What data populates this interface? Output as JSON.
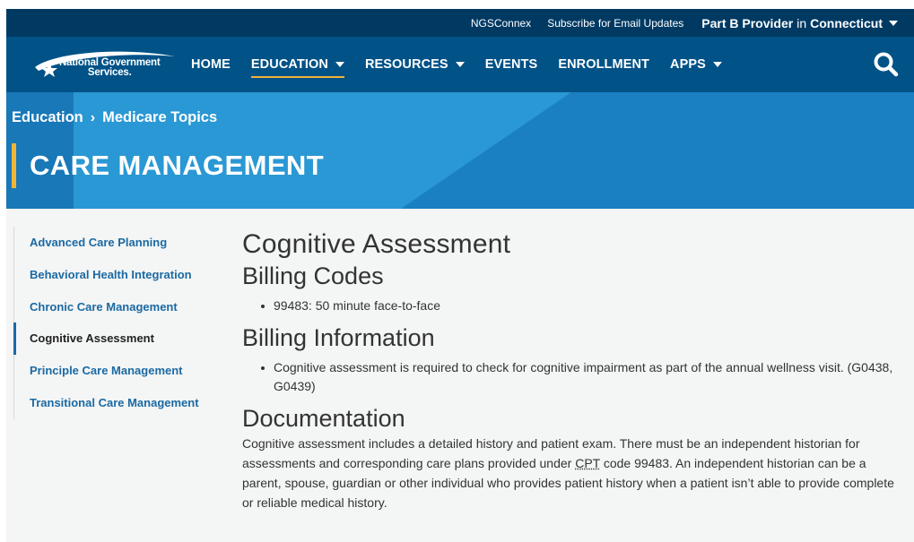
{
  "utility_bar": {
    "links": [
      "NGSConnex",
      "Subscribe for Email Updates"
    ],
    "provider_type": "Part B Provider",
    "provider_in": "in",
    "provider_state": "Connecticut"
  },
  "logo": {
    "line1": "National Government",
    "line2": "Services."
  },
  "nav": {
    "items": [
      {
        "label": "HOME",
        "dropdown": false
      },
      {
        "label": "EDUCATION",
        "dropdown": true
      },
      {
        "label": "RESOURCES",
        "dropdown": true
      },
      {
        "label": "EVENTS",
        "dropdown": false
      },
      {
        "label": "ENROLLMENT",
        "dropdown": false
      },
      {
        "label": "APPS",
        "dropdown": true
      }
    ]
  },
  "breadcrumb": {
    "items": [
      "Education",
      "Medicare Topics"
    ],
    "separator": "›"
  },
  "page_title": "CARE MANAGEMENT",
  "sidebar": {
    "items": [
      {
        "label": "Advanced Care Planning"
      },
      {
        "label": "Behavioral Health Integration"
      },
      {
        "label": "Chronic Care Management"
      },
      {
        "label": "Cognitive Assessment"
      },
      {
        "label": "Principle Care Management"
      },
      {
        "label": "Transitional Care Management"
      }
    ]
  },
  "main": {
    "title": "Cognitive Assessment",
    "billing_codes": {
      "heading": "Billing Codes",
      "items": [
        "99483: 50 minute face-to-face"
      ]
    },
    "billing_info": {
      "heading": "Billing Information",
      "items": [
        "Cognitive assessment is required to check for cognitive impairment as part of the annual wellness visit. (G0438, G0439)"
      ]
    },
    "documentation": {
      "heading": "Documentation",
      "text_before": "Cognitive assessment includes a detailed history and patient exam. There must be an independent historian for assessments and corresponding care plans provided under ",
      "abbr": "CPT",
      "text_after": " code 99483. An independent historian can be a parent, spouse, guardian or other individual who provides patient history when a patient isn’t able to provide complete or reliable medical history."
    }
  },
  "colors": {
    "utility_bar": "#003a63",
    "nav_bar": "#005287",
    "hero": "#1d87c9",
    "accent": "#f2b437",
    "link": "#1a6aa3"
  }
}
